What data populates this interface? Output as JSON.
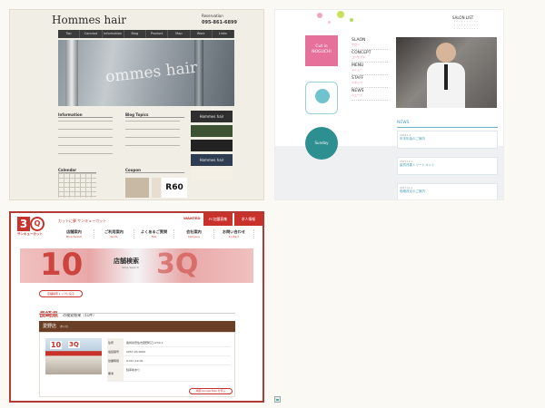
{
  "hommes": {
    "logo": "Hommes hair",
    "reservation": "Reservation",
    "tel": "095-861-6899",
    "nav": [
      "Top",
      "Concept",
      "Information",
      "Blog",
      "Product",
      "Map",
      "Work",
      "Links"
    ],
    "hero_text": "ommes hair",
    "information_title": "Information",
    "blog_title": "Blog Topics",
    "calendar_title": "Calendar",
    "coupon_title": "Coupon",
    "side_banner_1": "Hommes hair",
    "side_banner_2": "Hommes hair",
    "coupon_r60": "R60"
  },
  "noguchi": {
    "logo_line1": "Cut in",
    "logo_line2": "NOGUCHI",
    "menu": [
      {
        "en": "SLAON",
        "jp": "サロン"
      },
      {
        "en": "CONCEPT",
        "jp": "コンセプト"
      },
      {
        "en": "MENU",
        "jp": "メニュー"
      },
      {
        "en": "STAFF",
        "jp": "スタッフ"
      },
      {
        "en": "NEWS",
        "jp": "ニュース"
      }
    ],
    "salon_list": "SALON LIST",
    "badge2": "Sunday",
    "news_title": "NEWS",
    "news_items": [
      {
        "date": "2018.1.1",
        "title": "年末年始のご案内"
      },
      {
        "date": "2017.12.1",
        "title": "髪質改善トリートメント"
      },
      {
        "date": "2017.11.1",
        "title": "価格改定のご案内"
      }
    ]
  },
  "qcut": {
    "logo_3": "3",
    "logo_q": "Q",
    "name": "サンキューカット",
    "tag": "カットに夢 サンキューカット",
    "wanted": "WANTED",
    "top_buttons": [
      "FC加盟募集",
      "求人情報"
    ],
    "nav": [
      {
        "jp": "店舗案内",
        "en": "Shop Search"
      },
      {
        "jp": "ご利用案内",
        "en": "Guide"
      },
      {
        "jp": "よくあるご質問",
        "en": "FAQ"
      },
      {
        "jp": "会社案内",
        "en": "Company"
      },
      {
        "jp": "お問い合わせ",
        "en": "Contact"
      }
    ],
    "hero_title": "店舗検索",
    "hero_sub": "Shop Search",
    "hero_10": "10",
    "hero_3q": "3Q",
    "back_button": "店舗検索トップに戻る",
    "result_pref": "長崎県",
    "result_count": "の検索結果（11件）",
    "shop_name": "愛野店",
    "shop_kana": "あいの",
    "img_label_1": "10",
    "img_label_2": "3Q",
    "info_rows": [
      {
        "k": "住所",
        "v": "長崎県雲仙市愛野町乙1234-1"
      },
      {
        "k": "電話番号",
        "v": "0957-00-0000"
      },
      {
        "k": "営業時間",
        "v": "9:00〜19:00"
      },
      {
        "k": "備考",
        "v": "駐車場あり"
      }
    ],
    "map_button": "地図 Google Map を見る"
  }
}
